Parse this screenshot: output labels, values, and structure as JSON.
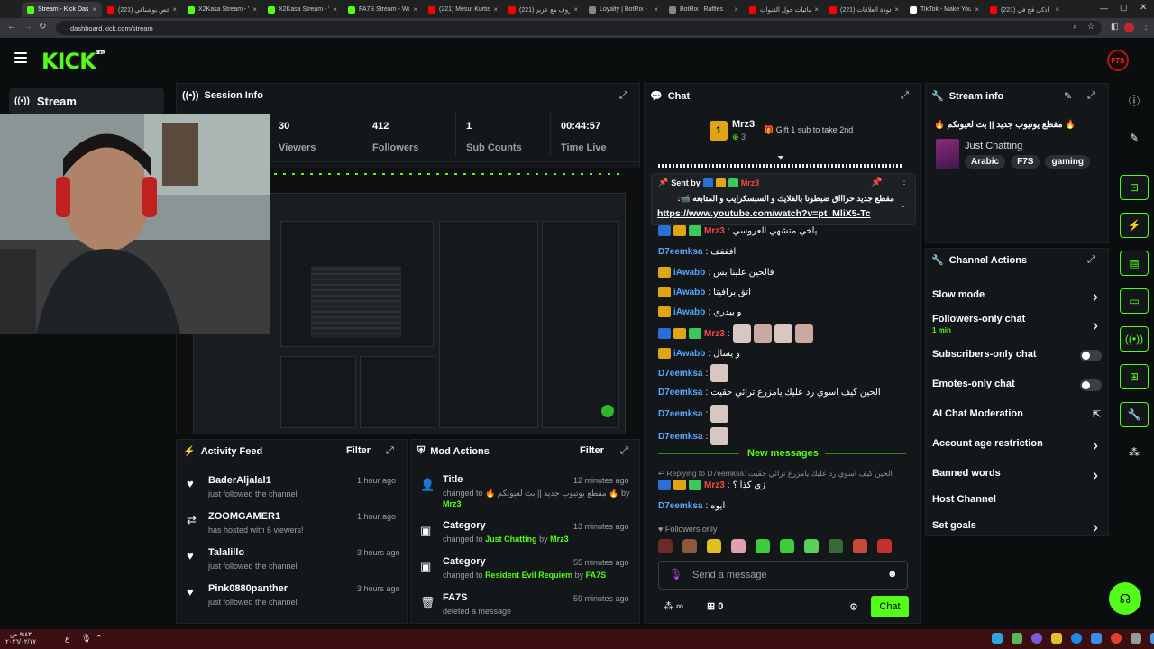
{
  "browser": {
    "tabs": [
      {
        "label": "Stream - Kick Dashb",
        "active": true,
        "color": "#53fc18"
      },
      {
        "label": "(221) ملخص بوشناقي",
        "active": false,
        "color": "#ff0000"
      },
      {
        "label": "X2Kasa Stream - Wa",
        "active": false,
        "color": "#53fc18"
      },
      {
        "label": "X2Kasa Stream - Wa",
        "active": false,
        "color": "#53fc18"
      },
      {
        "label": "FA7S Stream - Watc",
        "active": false,
        "color": "#53fc18"
      },
      {
        "label": "(221) Mesut Kurtis",
        "active": false,
        "color": "#ff0000"
      },
      {
        "label": "(221) حروف مع عزيز",
        "active": false,
        "color": "#ff0000"
      },
      {
        "label": "Loyalty | BotRix -",
        "active": false,
        "color": "#888888"
      },
      {
        "label": "BotRix | Raffles",
        "active": false,
        "color": "#888888"
      },
      {
        "label": "إحصائيات حول القنوات",
        "active": false,
        "color": "#ff0000"
      },
      {
        "label": "(221) عودة العلاقات",
        "active": false,
        "color": "#ff0000"
      },
      {
        "label": "TikTok - Make Your",
        "active": false,
        "color": "#ffffff"
      },
      {
        "label": "(221) اذكى فح في",
        "active": false,
        "color": "#ff0000"
      }
    ],
    "url": "dashboard.kick.com/stream"
  },
  "header": {
    "logo": "KICK",
    "logo_badge": "BETA"
  },
  "sidebar": {
    "stream_label": "Stream"
  },
  "session_info": {
    "title": "Session Info",
    "stats": [
      {
        "value": "30",
        "label": "Viewers"
      },
      {
        "value": "412",
        "label": "Followers"
      },
      {
        "value": "1",
        "label": "Sub Counts"
      },
      {
        "value": "00:44:57",
        "label": "Time Live"
      }
    ]
  },
  "activity_feed": {
    "title": "Activity Feed",
    "filter": "Filter",
    "items": [
      {
        "name": "BaderAljalal1",
        "text": "just followed the channel",
        "time": "1 hour ago"
      },
      {
        "name": "ZOOMGAMER1",
        "text": "has hosted with 6 viewers!",
        "time": "1 hour ago"
      },
      {
        "name": "Talalillo",
        "text": "just followed the channel",
        "time": "3 hours ago"
      },
      {
        "name": "Pink0880panther",
        "text": "just followed the channel",
        "time": "3 hours ago"
      }
    ]
  },
  "mod_actions": {
    "title": "Mod Actions",
    "filter": "Filter",
    "items": [
      {
        "action": "Title",
        "time": "12 minutes ago",
        "line1": "changed to 🔥 مقطع يوتيوب جديد || بث لعيونكم 🔥 by",
        "by": "Mrz3"
      },
      {
        "action": "Category",
        "time": "13 minutes ago",
        "line1": "changed to",
        "value": "Just Chatting",
        "by": "Mrz3"
      },
      {
        "action": "Category",
        "time": "55 minutes ago",
        "line1": "changed to",
        "value": "Resident Evil Requiem",
        "by": "FA7S"
      },
      {
        "action": "FA7S",
        "time": "59 minutes ago",
        "line1": "deleted a message",
        "by": ""
      }
    ]
  },
  "chat": {
    "title": "Chat",
    "top_gifter": "Mrz3",
    "top_gifter_count": "3",
    "gift_prompt": "Gift 1 sub to take 2nd",
    "pinned": {
      "sent_by_label": "Sent by",
      "sender": "Mrz3",
      "text": "مقطع جديد حراااق ضبطونا بالفلايك و السبسكرايب و المتابعه 📹:",
      "link": "https://www.youtube.com/watch?v=pt_MliX5-Tc"
    },
    "messages": [
      {
        "user": "Mrz3",
        "text": "ياخي متشهي العروسي",
        "badges": [
          "blue",
          "gold",
          "green"
        ],
        "color": "red"
      },
      {
        "user": "D7eemksa",
        "text": "افففف",
        "badges": [],
        "color": "blue"
      },
      {
        "user": "iAwabb",
        "text": "فالحين علينا بس",
        "badges": [
          "gold"
        ],
        "color": "gold"
      },
      {
        "user": "iAwabb",
        "text": "اتق برافيتا",
        "badges": [
          "gold"
        ],
        "color": "gold"
      },
      {
        "user": "iAwabb",
        "text": "و بيدري",
        "badges": [
          "gold"
        ],
        "color": "gold"
      },
      {
        "user": "Mrz3",
        "text": "",
        "badges": [
          "blue",
          "gold",
          "green"
        ],
        "color": "red",
        "emotes": 4
      },
      {
        "user": "iAwabb",
        "text": "و يسال",
        "badges": [
          "gold"
        ],
        "color": "gold"
      },
      {
        "user": "D7eemksa",
        "text": "",
        "badges": [],
        "color": "blue",
        "emotes": 1
      },
      {
        "user": "D7eemksa",
        "text": "الحين كيف اسوي رد عليك يامزرع ترائي حقيت",
        "badges": [],
        "color": "blue"
      },
      {
        "user": "D7eemksa",
        "text": "",
        "badges": [],
        "color": "blue",
        "emotes": 1
      },
      {
        "user": "D7eemksa",
        "text": "",
        "badges": [],
        "color": "blue",
        "emotes": 1
      }
    ],
    "new_messages": "New messages",
    "reply_label": "Replying to D7eemksa:",
    "reply_quote": "الحين كيف اسوي رد عليك يامزرع ترائي حقيت",
    "reply_user": "Mrz3",
    "reply_text": "زي كذا ؟",
    "last_user": "D7eemksa",
    "last_text": "ايوه",
    "followers_only": "Followers only",
    "input_placeholder": "Send a message",
    "points": "∞",
    "drops": "0",
    "send_label": "Chat"
  },
  "stream_info": {
    "title": "Stream info",
    "stream_title": "🔥 مقطع يوتيوب جديد || بث لعيونكم 🔥",
    "category": "Just Chatting",
    "tags": [
      "Arabic",
      "F7S",
      "gaming"
    ]
  },
  "channel_actions": {
    "title": "Channel Actions",
    "items": [
      {
        "label": "Slow mode",
        "control": "chevron"
      },
      {
        "label": "Followers-only chat",
        "sub": "1 min",
        "control": "chevron"
      },
      {
        "label": "Subscribers-only chat",
        "control": "toggle"
      },
      {
        "label": "Emotes-only chat",
        "control": "toggle"
      },
      {
        "label": "AI Chat Moderation",
        "control": "external"
      },
      {
        "label": "Account age restriction",
        "control": "chevron"
      },
      {
        "label": "Banned words",
        "control": "chevron"
      },
      {
        "label": "Host Channel",
        "control": "none"
      },
      {
        "label": "Set goals",
        "control": "chevron"
      }
    ]
  },
  "taskbar": {
    "time": "٩:٤٣ ص",
    "date": "٢٠٢٦/٠٢/١٧",
    "lang": "ع"
  }
}
